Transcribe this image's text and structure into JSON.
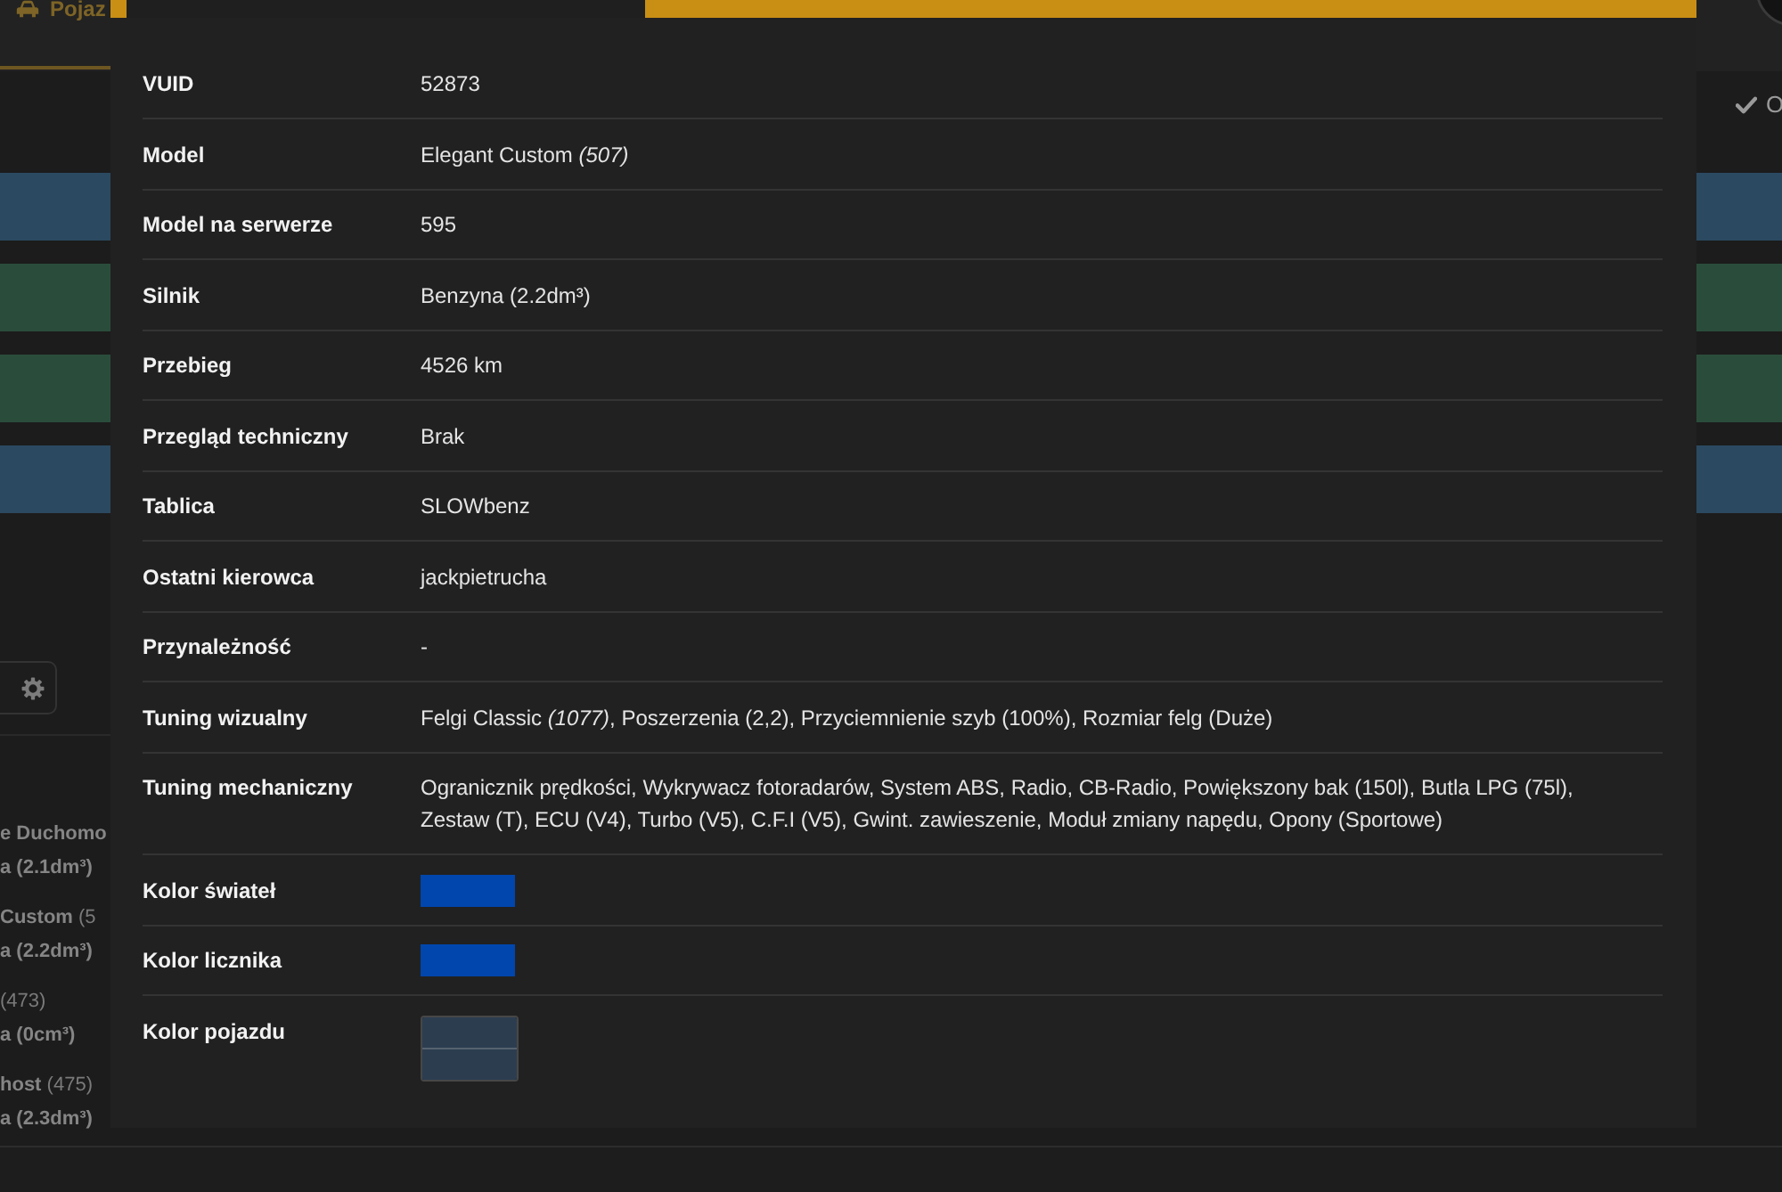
{
  "nav_tab": {
    "label": "Pojaz",
    "selected": true
  },
  "toolbar_button": {
    "label": "O"
  },
  "table_rows": [
    {
      "color": "#2b4961"
    },
    {
      "color": "#2a4d3b"
    },
    {
      "color": "#2a4d3b"
    },
    {
      "color": "#2b4961"
    }
  ],
  "vehicle_list": [
    {
      "name": "e Duchomo",
      "engine": "a (2.1dm³)"
    },
    {
      "name": "Custom",
      "number": "(5",
      "engine": "a (2.2dm³)"
    },
    {
      "number": "(473)",
      "engine": "a (0cm³)"
    },
    {
      "name": "host",
      "number": "(475)",
      "engine": "a (2.3dm³)"
    }
  ],
  "details": [
    {
      "label": "VUID",
      "kind": "text",
      "value": "52873"
    },
    {
      "label": "Model",
      "kind": "text",
      "value": "Elegant Custom *(507)*"
    },
    {
      "label": "Model na serwerze",
      "kind": "text",
      "value": "595"
    },
    {
      "label": "Silnik",
      "kind": "text",
      "value": "Benzyna (2.2dm³)"
    },
    {
      "label": "Przebieg",
      "kind": "text",
      "value": "4526 km"
    },
    {
      "label": "Przegląd techniczny",
      "kind": "text",
      "value": "Brak"
    },
    {
      "label": "Tablica",
      "kind": "text",
      "value": "SLOWbenz"
    },
    {
      "label": "Ostatni kierowca",
      "kind": "text",
      "value": "jackpietrucha"
    },
    {
      "label": "Przynależność",
      "kind": "text",
      "value": "-"
    },
    {
      "label": "Tuning wizualny",
      "kind": "text",
      "value": "Felgi Classic *(1077)*, Poszerzenia (2,2), Przyciemnienie szyb (100%), Rozmiar felg (Duże)"
    },
    {
      "label": "Tuning mechaniczny",
      "kind": "text",
      "value": "Ogranicznik prędkości, Wykrywacz fotoradarów, System ABS, Radio, CB-Radio, Powiększony bak (150l), Butla LPG (75l), Zestaw (T), ECU (V4), Turbo (V5), C.F.I (V5), Gwint. zawieszenie, Moduł zmiany napędu, Opony (Sportowe)"
    },
    {
      "label": "Kolor świateł",
      "kind": "color",
      "swatches": [
        {
          "color": "#0046ad"
        }
      ]
    },
    {
      "label": "Kolor licznika",
      "kind": "color",
      "swatches": [
        {
          "color": "#0046ad"
        }
      ]
    },
    {
      "label": "Kolor pojazdu",
      "kind": "paint",
      "swatches": [
        {
          "color": "#2c3d50"
        },
        {
          "color": "#2c3d50"
        }
      ]
    }
  ]
}
